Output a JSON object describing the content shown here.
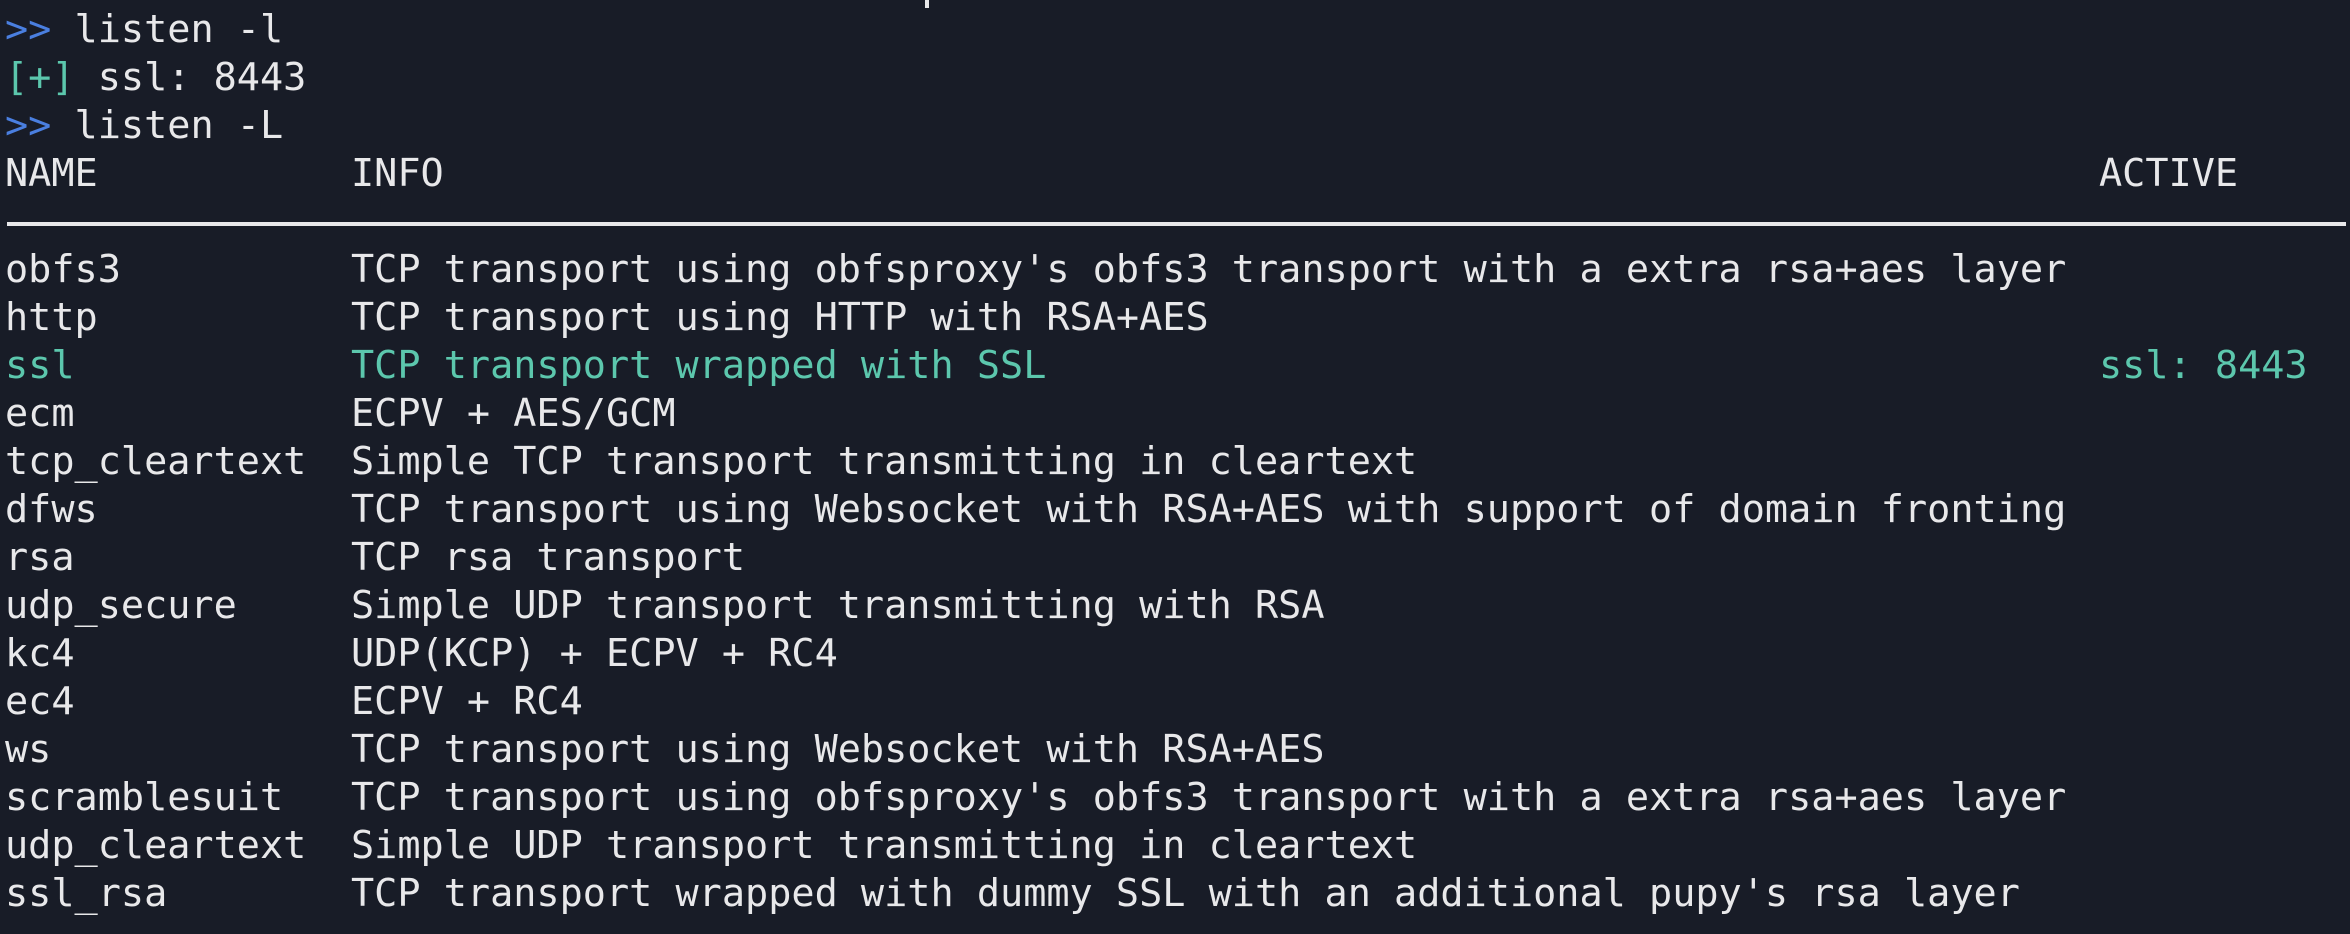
{
  "colors": {
    "background": "#181c27",
    "text": "#e8e8ea",
    "prompt": "#4a7fe0",
    "success": "#5cc7ad"
  },
  "session": [
    {
      "prompt": ">>",
      "command": "listen -l"
    },
    {
      "status": "[+]",
      "text": "ssl: 8443"
    },
    {
      "prompt": ">>",
      "command": "listen -L"
    }
  ],
  "table": {
    "headers": {
      "name": "NAME",
      "info": "INFO",
      "active": "ACTIVE"
    },
    "rows": [
      {
        "name": "obfs3",
        "info": "TCP transport using obfsproxy's obfs3 transport with a extra rsa+aes layer",
        "active": ""
      },
      {
        "name": "http",
        "info": "TCP transport using HTTP with RSA+AES",
        "active": ""
      },
      {
        "name": "ssl",
        "info": "TCP transport wrapped with SSL",
        "active": "ssl: 8443"
      },
      {
        "name": "ecm",
        "info": "ECPV + AES/GCM",
        "active": ""
      },
      {
        "name": "tcp_cleartext",
        "info": "Simple TCP transport transmitting in cleartext",
        "active": ""
      },
      {
        "name": "dfws",
        "info": "TCP transport using Websocket with RSA+AES with support of domain fronting",
        "active": ""
      },
      {
        "name": "rsa",
        "info": "TCP rsa transport",
        "active": ""
      },
      {
        "name": "udp_secure",
        "info": "Simple UDP transport transmitting with RSA",
        "active": ""
      },
      {
        "name": "kc4",
        "info": "UDP(KCP) + ECPV + RC4",
        "active": ""
      },
      {
        "name": "ec4",
        "info": "ECPV + RC4",
        "active": ""
      },
      {
        "name": "ws",
        "info": "TCP transport using Websocket with RSA+AES",
        "active": ""
      },
      {
        "name": "scramblesuit",
        "info": "TCP transport using obfsproxy's obfs3 transport with a extra rsa+aes layer",
        "active": ""
      },
      {
        "name": "udp_cleartext",
        "info": "Simple UDP transport transmitting in cleartext",
        "active": ""
      },
      {
        "name": "ssl_rsa",
        "info": "TCP transport wrapped with dummy SSL with an additional pupy's rsa layer",
        "active": ""
      }
    ]
  }
}
